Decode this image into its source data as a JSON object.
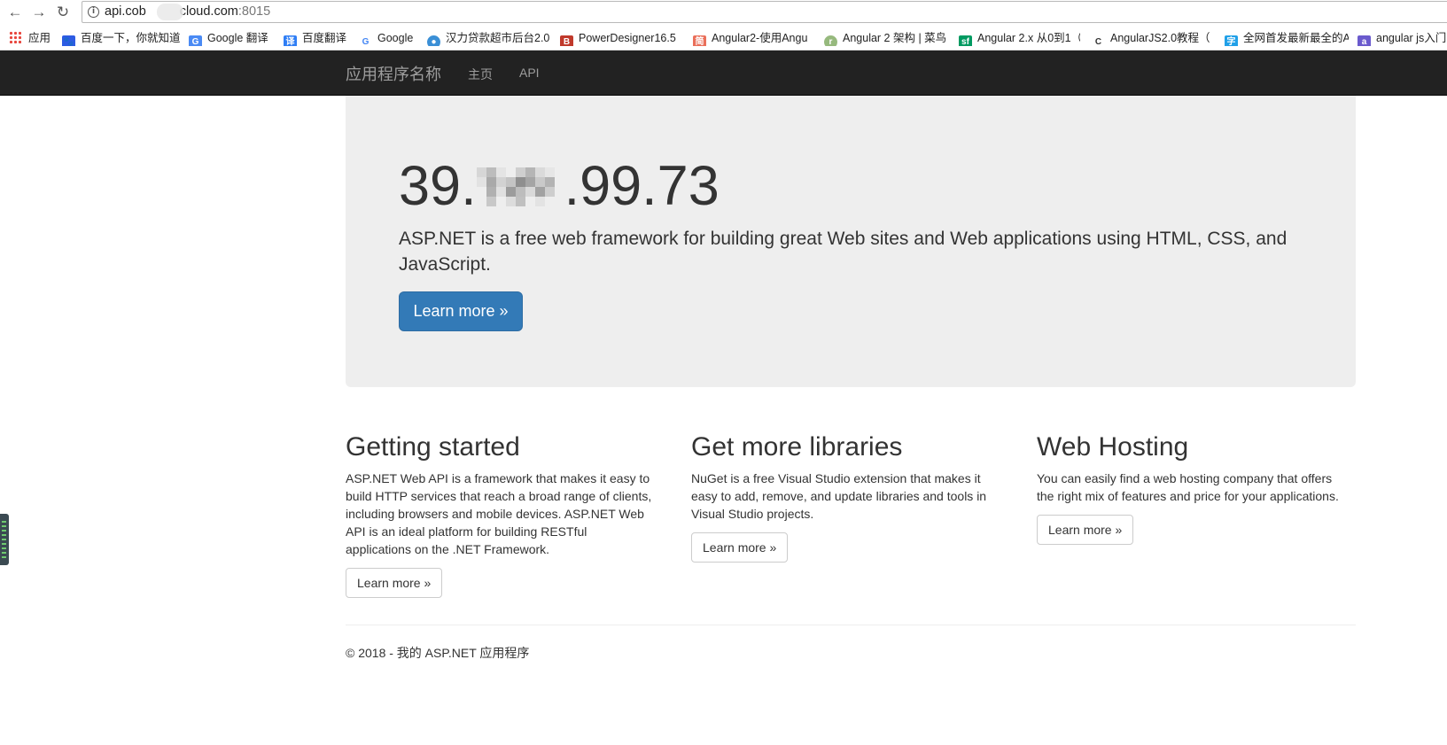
{
  "browser": {
    "url_host_start": "api.cob",
    "url_host_end": "cloud.com",
    "url_port": ":8015",
    "bookmarks": [
      {
        "label": "应用",
        "icon": "apps-grid-icon"
      },
      {
        "label": "百度一下，你就知道",
        "icon": "baidu-paw-icon"
      },
      {
        "label": "Google 翻译",
        "icon": "google-translate-icon"
      },
      {
        "label": "百度翻译",
        "icon": "baidu-translate-icon"
      },
      {
        "label": "Google",
        "icon": "google-g-icon"
      },
      {
        "label": "汉力贷款超市后台2.0",
        "icon": "globe-icon"
      },
      {
        "label": "PowerDesigner16.5",
        "icon": "powerdesigner-icon"
      },
      {
        "label": "Angular2-使用Angu",
        "icon": "jianshu-icon"
      },
      {
        "label": "Angular 2 架构 | 菜鸟",
        "icon": "runoob-icon"
      },
      {
        "label": "Angular 2.x 从0到1（",
        "icon": "segmentfault-icon"
      },
      {
        "label": "AngularJS2.0教程（",
        "icon": "csdn-c-icon"
      },
      {
        "label": "全网首发最新最全的A",
        "icon": "bookmark-blue-icon"
      },
      {
        "label": "angular js入门",
        "icon": "bookmark-purple-icon"
      }
    ]
  },
  "navbar": {
    "brand": "应用程序名称",
    "links": [
      "主页",
      "API"
    ]
  },
  "jumbotron": {
    "title_start": "39.",
    "title_end": ".99.73",
    "lead": "ASP.NET is a free web framework for building great Web sites and Web applications using HTML, CSS, and JavaScript.",
    "button": "Learn more »"
  },
  "columns": [
    {
      "heading": "Getting started",
      "text": "ASP.NET Web API is a framework that makes it easy to build HTTP services that reach a broad range of clients, including browsers and mobile devices. ASP.NET Web API is an ideal platform for building RESTful applications on the .NET Framework.",
      "button": "Learn more »"
    },
    {
      "heading": "Get more libraries",
      "text": "NuGet is a free Visual Studio extension that makes it easy to add, remove, and update libraries and tools in Visual Studio projects.",
      "button": "Learn more »"
    },
    {
      "heading": "Web Hosting",
      "text": "You can easily find a web hosting company that offers the right mix of features and price for your applications.",
      "button": "Learn more »"
    }
  ],
  "footer": {
    "text": "© 2018 - 我的 ASP.NET 应用程序"
  },
  "colors": {
    "navbar_bg": "#222222",
    "jumbotron_bg": "#eeeeee",
    "primary": "#337ab7"
  }
}
